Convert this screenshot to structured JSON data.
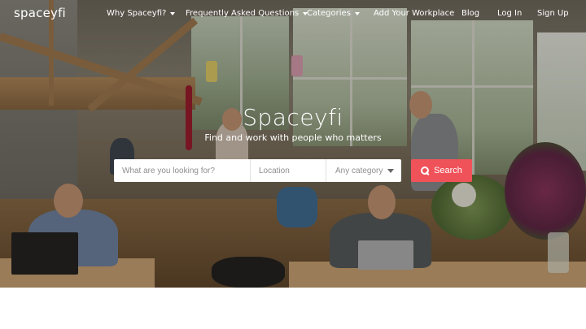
{
  "brand": {
    "logo_text": "spaceyfi"
  },
  "nav": {
    "items": [
      {
        "label": "Why Spaceyfi?",
        "has_dropdown": true
      },
      {
        "label": "Frequently Asked Questions",
        "has_dropdown": true
      },
      {
        "label": "Categories",
        "has_dropdown": true
      },
      {
        "label": "Add Your Workplace",
        "has_dropdown": false
      },
      {
        "label": "Blog",
        "has_dropdown": false
      },
      {
        "label": "Log In",
        "has_dropdown": false
      },
      {
        "label": "Sign Up",
        "has_dropdown": false
      }
    ]
  },
  "hero": {
    "title": "Spaceyfi",
    "subtitle": "Find and work with people who matters"
  },
  "search": {
    "what_placeholder": "What are you looking for?",
    "what_value": "",
    "location_placeholder": "Location",
    "location_value": "",
    "category_selected": "Any category",
    "button_label": "Search",
    "button_icon": "search-icon"
  },
  "colors": {
    "accent": "#f0525a",
    "nav_text": "#ffffff"
  }
}
